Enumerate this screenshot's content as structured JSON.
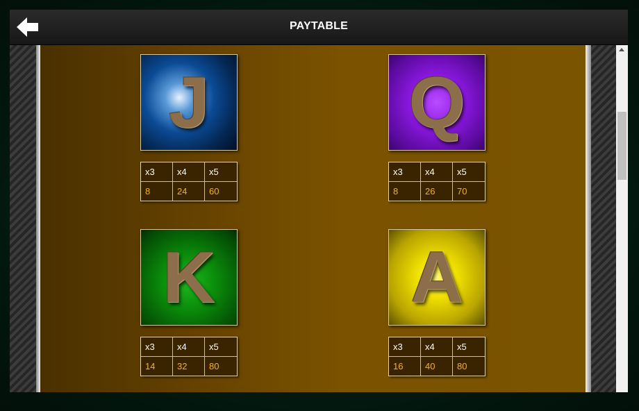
{
  "header": {
    "title": "PAYTABLE",
    "back_icon": "arrow-left-icon"
  },
  "symbols": [
    {
      "letter": "J",
      "color": "#0b4a94",
      "payouts": {
        "headers": [
          "x3",
          "x4",
          "x5"
        ],
        "values": [
          "8",
          "24",
          "60"
        ]
      }
    },
    {
      "letter": "Q",
      "color": "#8a18e0",
      "payouts": {
        "headers": [
          "x3",
          "x4",
          "x5"
        ],
        "values": [
          "8",
          "26",
          "70"
        ]
      }
    },
    {
      "letter": "K",
      "color": "#0a8a0a",
      "payouts": {
        "headers": [
          "x3",
          "x4",
          "x5"
        ],
        "values": [
          "14",
          "32",
          "80"
        ]
      }
    },
    {
      "letter": "A",
      "color": "#f0e000",
      "payouts": {
        "headers": [
          "x3",
          "x4",
          "x5"
        ],
        "values": [
          "16",
          "40",
          "80"
        ]
      }
    }
  ],
  "colors": {
    "payout_value": "#f6b21a",
    "background": "#7a5200",
    "header_text": "#ffffff"
  }
}
